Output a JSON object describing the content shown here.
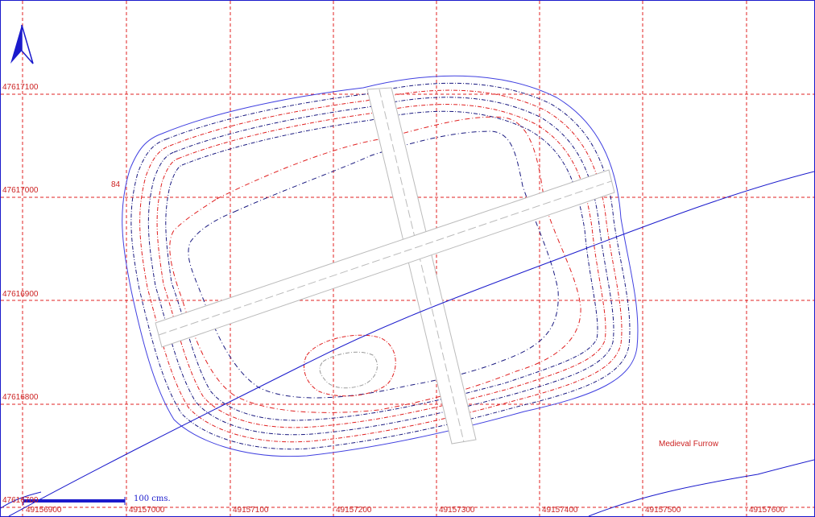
{
  "map": {
    "north_arrow": {
      "icon": "north-arrow-icon",
      "color": "#1a1acc"
    },
    "grid_color": "#e02020",
    "label_color": "#cc2222",
    "y_labels": [
      "47617100",
      "47617000",
      "47616900",
      "47616800",
      "47616700"
    ],
    "x_labels": [
      "49156900",
      "49157000",
      "49157100",
      "49157200",
      "49157300",
      "49157400",
      "49157500",
      "49157600"
    ],
    "contour_label": "84",
    "feature_label": "Medieval Furrow",
    "scale_bar": {
      "label": "100 cms.",
      "color": "#1a1acc"
    }
  }
}
